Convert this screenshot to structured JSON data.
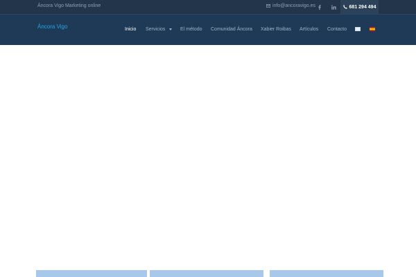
{
  "topbar": {
    "tagline": "Áncora Vigo Marketing online",
    "email": "info@ancoravigo.es",
    "phone": "681 294 494"
  },
  "header": {
    "logo": "Áncora Vigo",
    "nav": [
      {
        "label": "Inicio",
        "active": true
      },
      {
        "label": "Servicios",
        "has_dropdown": true
      },
      {
        "label": "El método"
      },
      {
        "label": "Comunidad Áncora"
      },
      {
        "label": "Xabier Roibas"
      },
      {
        "label": "Artículos"
      },
      {
        "label": "Contacto"
      }
    ],
    "languages": [
      "uk-flag",
      "es-flag"
    ]
  },
  "icons": {
    "email": "envelope-icon",
    "facebook": "facebook-icon",
    "linkedin": "linkedin-icon",
    "phone": "phone-icon",
    "dropdown": "chevron-down-icon"
  },
  "colors": {
    "topbar_bg": "#23354a",
    "header_bg": "#1f3a57",
    "logo": "#1fa8e0",
    "card": "#a7c8e8"
  }
}
